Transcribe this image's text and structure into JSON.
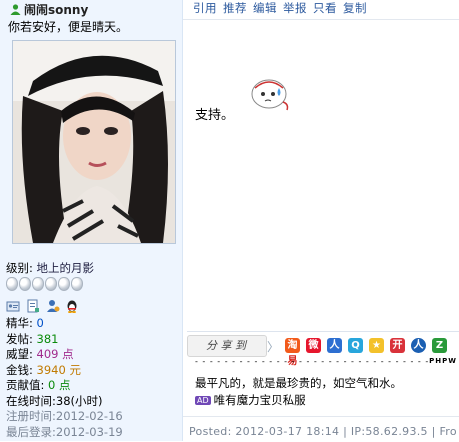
{
  "user": {
    "name": "闹闹sonny",
    "signature": "你若安好，便是晴天。",
    "level_label": "级别:",
    "level_value": "地上的月影",
    "orb_count": 6
  },
  "stats": {
    "jinghua_label": "精华:",
    "jinghua_value": "0",
    "posts_label": "发帖:",
    "posts_value": "381",
    "weiwang_label": "威望:",
    "weiwang_value": "409 点",
    "money_label": "金钱:",
    "money_value": "3940 元",
    "contrib_label": "贡献值:",
    "contrib_value": "0 点",
    "online_label": "在线时间:",
    "online_value": "38(小时)",
    "reg_label": "注册时间:",
    "reg_value": "2012-02-16",
    "last_label": "最后登录:",
    "last_value": "2012-03-19"
  },
  "actions": {
    "quote": "引用",
    "recommend": "推荐",
    "edit": "编辑",
    "report": "举报",
    "only_view": "只看",
    "copy": "复制"
  },
  "post": {
    "content": "支持。",
    "share_label": "分 享 到",
    "separator_tag": "PHPW",
    "motto": "最平凡的，就是最珍贵的，如空气和水。",
    "ad_badge": "AD",
    "ad_text": "唯有魔力宝贝私服",
    "footer": "Posted: 2012-03-17 18:14 | IP:58.62.93.5 | Fro"
  },
  "share_icons": [
    "淘",
    "微",
    "人",
    "Q",
    "★",
    "开",
    "人",
    "Z",
    "易"
  ],
  "colors": {
    "link": "#2d5a9e",
    "sidebar_bg": "#eef5fe",
    "posts_green": "#0a8a0a",
    "weiwang_purple": "#a02a8c",
    "money_orange": "#c07a00",
    "jinghua_blue": "#0050c8"
  },
  "icons": [
    "user-green-icon",
    "profile-card-icon",
    "message-icon",
    "add-friend-icon",
    "qq-penguin-icon",
    "level-orb-icon",
    "emoticon-icon"
  ]
}
